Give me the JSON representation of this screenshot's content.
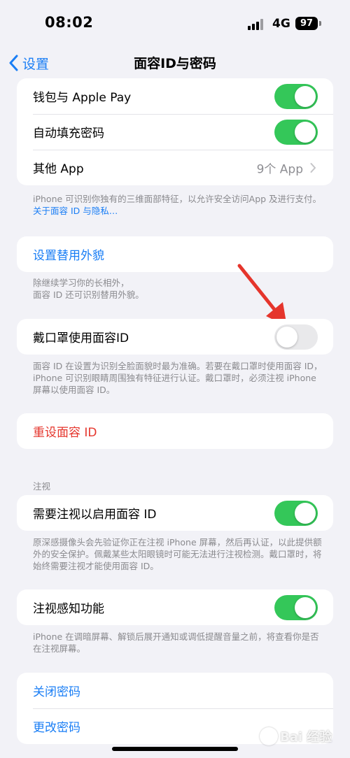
{
  "status_bar": {
    "time": "08:02",
    "network": "4G",
    "battery": "97"
  },
  "nav": {
    "back_label": "设置",
    "title": "面容ID与密码"
  },
  "use_for": {
    "items": [
      {
        "label": "钱包与 Apple Pay",
        "toggle": "on"
      },
      {
        "label": "自动填充密码",
        "toggle": "on"
      },
      {
        "label": "其他 App",
        "value": "9个 App"
      }
    ],
    "footer_text": "iPhone 可识别你独有的三维面部特征，以允许安全访问App 及进行支付。",
    "footer_link": "关于面容 ID 与隐私…"
  },
  "alternate_appearance": {
    "label": "设置替用外貌",
    "footer_line1": "除继续学习你的长相外，",
    "footer_line2": "面容 ID 还可识别替用外貌。"
  },
  "mask": {
    "label": "戴口罩使用面容ID",
    "toggle": "off",
    "footer": "面容 ID 在设置为识别全脸面貌时最为准确。若要在戴口罩时使用面容 ID，iPhone 可识别眼睛周围独有特征进行认证。戴口罩时，必须注视 iPhone 屏幕以使用面容 ID。"
  },
  "reset": {
    "label": "重设面容 ID"
  },
  "attention": {
    "header": "注视",
    "require_label": "需要注视以启用面容 ID",
    "require_toggle": "on",
    "require_footer": "原深感摄像头会先验证你正在注视 iPhone 屏幕，然后再认证，以此提供额外的安全保护。佩戴某些太阳眼镜时可能无法进行注视检测。戴口罩时，将始终需要注视才能使用面容 ID。",
    "aware_label": "注视感知功能",
    "aware_toggle": "on",
    "aware_footer": "iPhone 在调暗屏幕、解锁后展开通知或调低提醒音量之前，将查看你是否在注视屏幕。"
  },
  "passcode": {
    "turn_off_label": "关闭密码",
    "change_label": "更改密码"
  },
  "watermark": {
    "text": "Bai 经验"
  },
  "colors": {
    "accent": "#1a7ef5",
    "toggle_on": "#34c759",
    "toggle_off": "#e9e9eb",
    "destructive": "#e5352c",
    "annotation_arrow": "#e5352c",
    "background": "#f2f2f7"
  }
}
